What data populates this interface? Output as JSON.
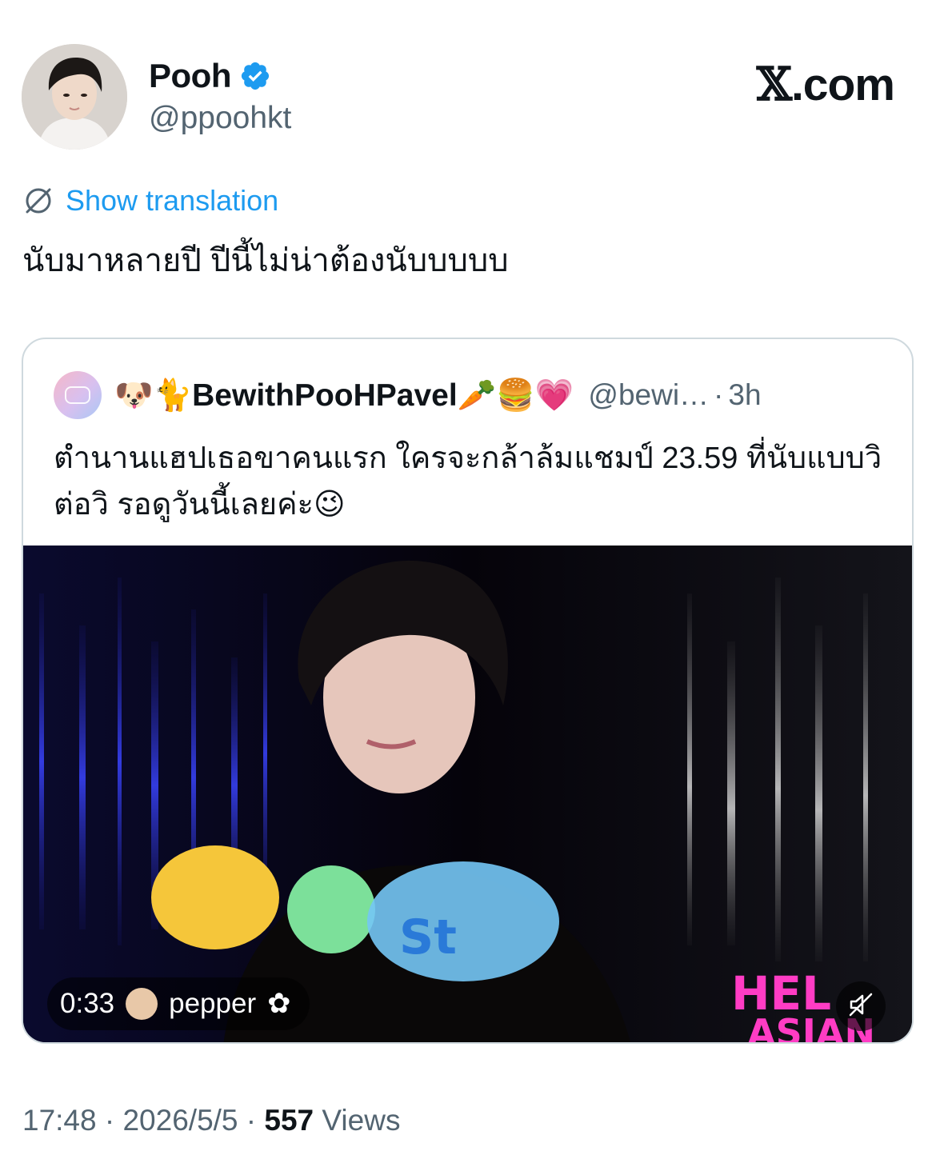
{
  "author": {
    "name": "Pooh",
    "handle": "@ppoohkt",
    "verified_icon": "verified-badge-icon",
    "verified_color": "#1d9bf0"
  },
  "brand": {
    "x_glyph": "𝕏",
    "domain": ".com"
  },
  "translation": {
    "label": "Show translation",
    "icon": "globe-icon",
    "color": "#1d9bf0"
  },
  "tweet": {
    "text": "นับมาหลายปี ปีนี้ไม่น่าต้องนับบบบบ"
  },
  "quote": {
    "name_prefix_emoji": "🐶🐈",
    "name": "BewithPooHPavel",
    "name_suffix_emoji": "🥕🍔💗",
    "handle": "@bewi…",
    "separator": "·",
    "time": "3h",
    "text": "ตำนานแฮปเธอขาคนแรก ใครจะกล้าล้มแชมป์ 23.59 ที่นับแบบวิต่อวิ รอดูวันนี้เลยค่ะ😉",
    "video": {
      "duration": "0:33",
      "uploader": "pepper",
      "uploader_flower": "✿",
      "mute_icon": "muted-speaker-icon"
    }
  },
  "meta": {
    "time": "17:48",
    "sep1": " · ",
    "date": "2026/5/5",
    "sep2": " · ",
    "views_count": "557",
    "views_label": " Views"
  }
}
